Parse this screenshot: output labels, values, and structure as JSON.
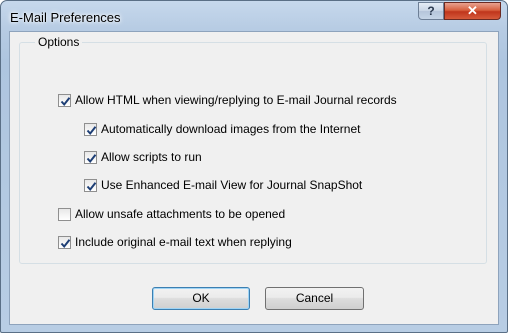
{
  "window": {
    "title": "E-Mail Preferences",
    "help_label": "?",
    "close_label": "✕"
  },
  "options": {
    "group_label": "Options",
    "items": [
      {
        "label": "Allow HTML when viewing/replying to E-mail Journal records",
        "checked": true
      },
      {
        "label": "Automatically download images from the Internet",
        "checked": true
      },
      {
        "label": "Allow scripts to run",
        "checked": true
      },
      {
        "label": "Use Enhanced E-mail View for Journal SnapShot",
        "checked": true
      },
      {
        "label": "Allow unsafe attachments to be opened",
        "checked": false
      },
      {
        "label": "Include original e-mail text when replying",
        "checked": true
      }
    ]
  },
  "buttons": {
    "ok_label": "OK",
    "cancel_label": "Cancel"
  }
}
